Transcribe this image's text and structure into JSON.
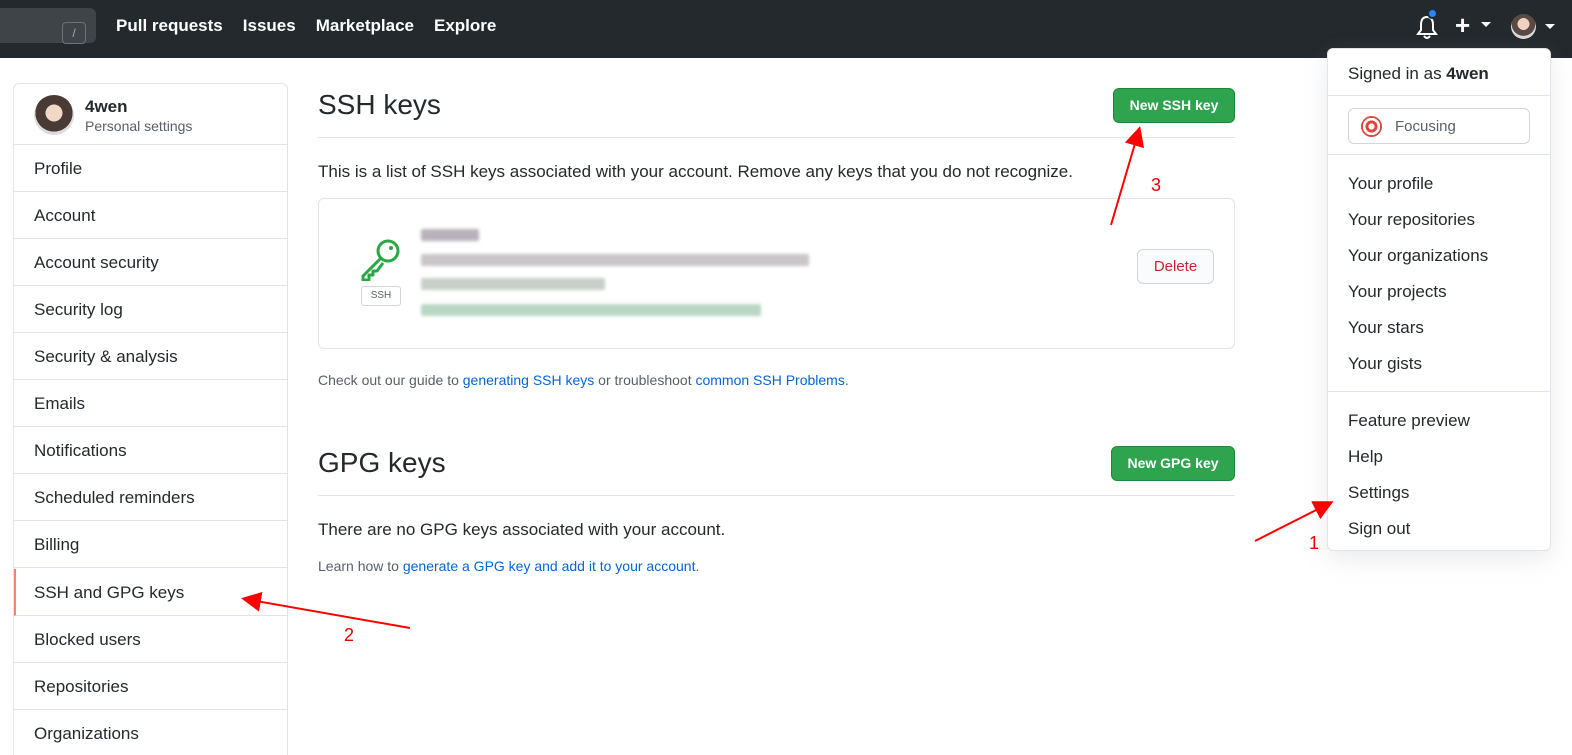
{
  "header": {
    "search_hint": "/",
    "nav": [
      "Pull requests",
      "Issues",
      "Marketplace",
      "Explore"
    ],
    "icons": [
      "bell-icon",
      "plus-icon",
      "avatar"
    ]
  },
  "sidebar": {
    "username": "4wen",
    "subtitle": "Personal settings",
    "items": [
      {
        "label": "Profile"
      },
      {
        "label": "Account"
      },
      {
        "label": "Account security"
      },
      {
        "label": "Security log"
      },
      {
        "label": "Security & analysis"
      },
      {
        "label": "Emails"
      },
      {
        "label": "Notifications"
      },
      {
        "label": "Scheduled reminders"
      },
      {
        "label": "Billing"
      },
      {
        "label": "SSH and GPG keys",
        "selected": true
      },
      {
        "label": "Blocked users"
      },
      {
        "label": "Repositories"
      },
      {
        "label": "Organizations"
      }
    ]
  },
  "ssh": {
    "title": "SSH keys",
    "new_button": "New SSH key",
    "description": "This is a list of SSH keys associated with your account. Remove any keys that you do not recognize.",
    "badge": "SSH",
    "delete_button": "Delete",
    "guide_prefix": "Check out our guide to ",
    "guide_link1": "generating SSH keys",
    "guide_mid": " or troubleshoot ",
    "guide_link2": "common SSH Problems",
    "guide_suffix": "."
  },
  "gpg": {
    "title": "GPG keys",
    "new_button": "New GPG key",
    "empty_text": "There are no GPG keys associated with your account.",
    "learn_prefix": "Learn how to ",
    "learn_link": "generate a GPG key and add it to your account",
    "learn_suffix": "."
  },
  "dropdown": {
    "signed_in_prefix": "Signed in as ",
    "signed_in_user": "4wen",
    "status": "Focusing",
    "group1": [
      "Your profile",
      "Your repositories",
      "Your organizations",
      "Your projects",
      "Your stars",
      "Your gists"
    ],
    "group2": [
      "Feature preview",
      "Help",
      "Settings",
      "Sign out"
    ]
  },
  "annotations": [
    "1",
    "2",
    "3"
  ],
  "colors": {
    "header_bg": "#24292e",
    "green": "#2ea44f",
    "link": "#0366d6",
    "danger": "#cb2431",
    "annotation": "#ff0000",
    "selected_marker": "#f9826c"
  }
}
